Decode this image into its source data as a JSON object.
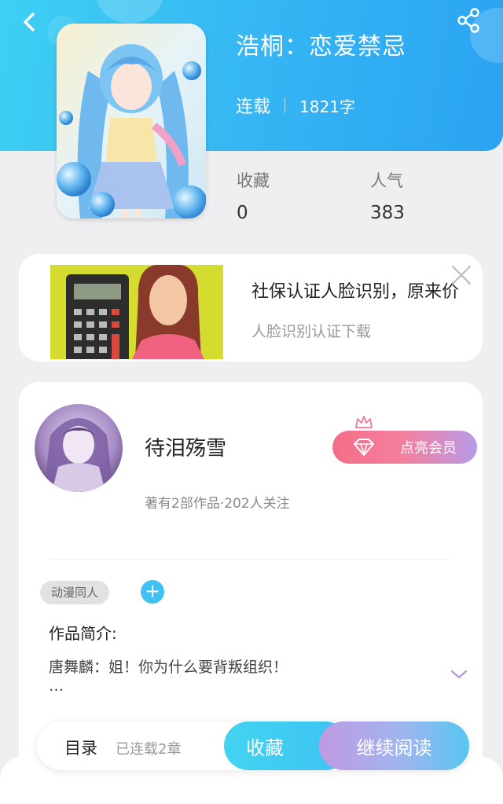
{
  "header": {
    "title": "浩桐：恋爱禁忌",
    "status": "连载",
    "word_count": "1821字"
  },
  "stats": [
    {
      "label": "收藏",
      "value": "0"
    },
    {
      "label": "人气",
      "value": "383"
    }
  ],
  "ad": {
    "title": "社保认证人脸识别，原来价",
    "subtitle": "人脸识别认证下载"
  },
  "author": {
    "name": "待泪殇雪",
    "meta": "著有2部作品·202人关注",
    "vip_label": "点亮会员"
  },
  "book": {
    "tag": "动漫同人",
    "add_tag": "+",
    "intro_label": "作品简介:",
    "intro_text": "唐舞麟：姐！你为什么要背叛组织！",
    "intro_ellipsis": "…"
  },
  "bottom_bar": {
    "catalog": "目录",
    "chapters": "已连载2章",
    "collect": "收藏",
    "read": "继续阅读"
  },
  "colors": {
    "header_blue": "#35b4f3",
    "accent_cyan": "#3fc2f1",
    "vip_pink": "#f56d87",
    "read_purple": "#c09ae3"
  }
}
